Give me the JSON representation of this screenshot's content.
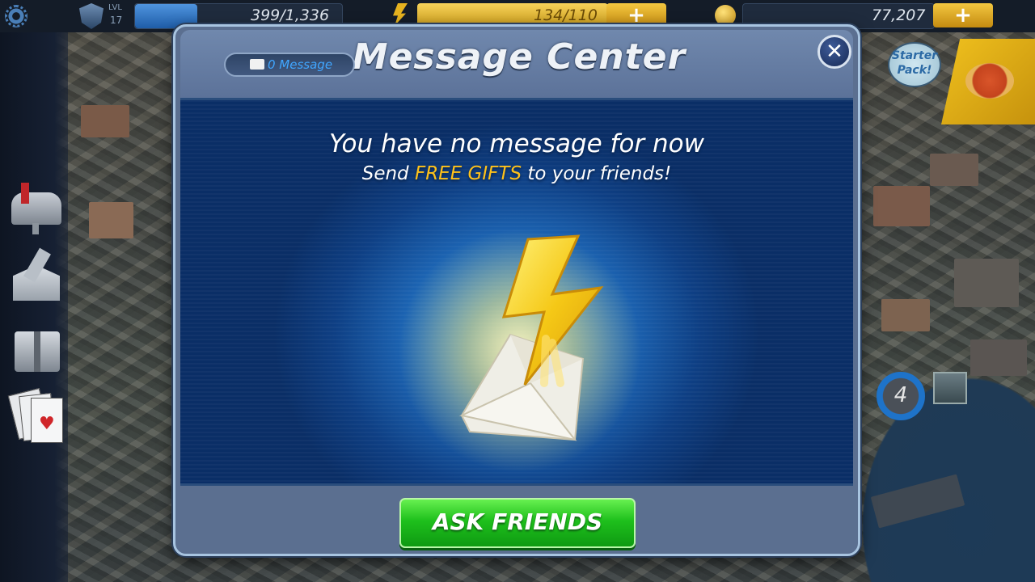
{
  "hud": {
    "level_label": "LVL",
    "level_value": "17",
    "xp": "399/1,336",
    "xp_fill": 0.3,
    "energy": "134/110",
    "coins": "77,207",
    "plus_label": "+"
  },
  "starter_pack": "Starter Pack!",
  "modal": {
    "title": "Message Center",
    "message_count": "0 Message",
    "close_label": "✕",
    "line1": "You have no message for now",
    "line2_prefix": "Send ",
    "line2_highlight": "FREE GIFTS",
    "line2_suffix": " to your friends!",
    "button": "ASK FRIENDS"
  },
  "map_badge": "4",
  "icons": [
    "settings-gear-icon",
    "shield-level-icon",
    "energy-bolt-icon",
    "coin-icon",
    "mailbox-icon",
    "send-mail-icon",
    "gift-box-icon",
    "cards-icon",
    "pizza-icon",
    "map-pin-icon",
    "player-avatar-icon"
  ],
  "colors": {
    "accent_gold": "#ffc21a",
    "button_green": "#1ec01c",
    "xp_blue": "#2a6fc1",
    "panel_blue": "#1f6cbd"
  }
}
